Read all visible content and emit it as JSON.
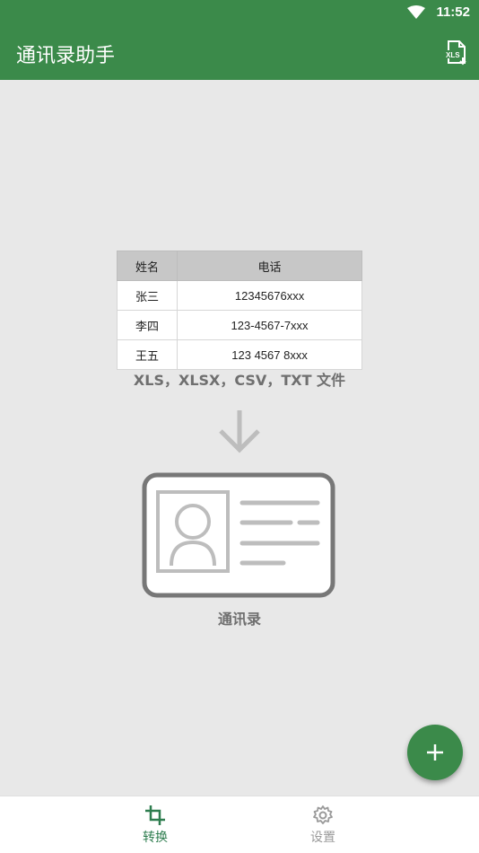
{
  "status_bar": {
    "time": "11:52"
  },
  "app_bar": {
    "title": "通讯录助手",
    "action_icon": "xls-file-icon"
  },
  "sample_table": {
    "headers": [
      "姓名",
      "电话"
    ],
    "rows": [
      [
        "张三",
        "12345676xxx"
      ],
      [
        "李四",
        "123-4567-7xxx"
      ],
      [
        "王五",
        "123 4567 8xxx"
      ]
    ]
  },
  "file_types_text": "XLS，XLSX，CSV，TXT 文件",
  "contacts_label": "通讯录",
  "fab": {
    "icon": "plus-icon"
  },
  "bottom_nav": {
    "items": [
      {
        "label": "转换",
        "icon": "crop-icon",
        "active": true
      },
      {
        "label": "设置",
        "icon": "gear-icon",
        "active": false
      }
    ]
  },
  "colors": {
    "primary": "#3b8a4a",
    "active_nav": "#2e7d4f",
    "inactive_nav": "#9a9a9a",
    "background": "#e8e8e8"
  }
}
